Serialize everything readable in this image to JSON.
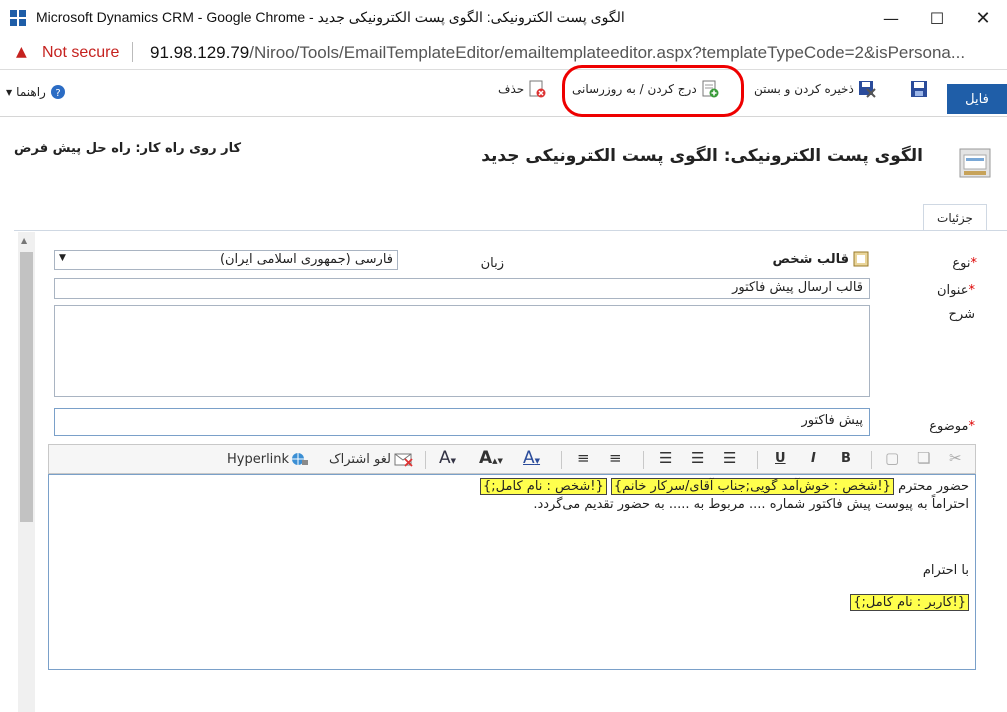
{
  "window": {
    "title": "Microsoft Dynamics CRM - Google Chrome - الگوی پست الکترونیکی: الگوی پست الکترونیکی جدید",
    "controls": [
      "minimize-icon",
      "maximize-icon",
      "close-icon"
    ]
  },
  "addressbar": {
    "security_label": "Not secure",
    "url_host": "91.98.129.79",
    "url_path": "/Niroo/Tools/EmailTemplateEditor/emailtemplateeditor.aspx?templateTypeCode=2&isPersona..."
  },
  "ribbon": {
    "file_tab": "فایل",
    "save_close": "ذخیره کردن و بستن",
    "insert_update": "درج کردن / به روزرسانی",
    "delete": "حذف",
    "help": "راهنما"
  },
  "header": {
    "title": "الگوی پست الکترونیکی: الگوی پست الکترونیکی جدید",
    "working_on": "کار روی راه کار: راه حل پیش فرض"
  },
  "tabs": {
    "details": "جزئیات"
  },
  "form": {
    "type_label": "نوع",
    "type_value": "قالب شخص",
    "language_label": "زبان",
    "language_value": "فارسی (جمهوری اسلامی ایران)",
    "title_label": "عنوان",
    "title_value": "قالب ارسال پیش فاکتور",
    "description_label": "شرح",
    "subject_label": "موضوع",
    "subject_value": "پیش فاکتور",
    "required_mark": "*"
  },
  "toolbar": {
    "hyperlink": "Hyperlink",
    "unsubscribe": "لغو اشتراک",
    "bold": "B",
    "italic": "I",
    "underline": "U",
    "font_color": "A",
    "font_size": "A",
    "highlight": "A"
  },
  "editor": {
    "greeting": "حضور محترم",
    "tag_salutation": "{!شخص : خوش‌آمد گویی;جناب آقای/سرکار خانم}",
    "tag_fullname": "{!شخص : نام کامل;}",
    "body_line": "احتراماً به پیوست پیش فاکتور شماره .... مربوط به ..... به حضور تقدیم می‌گردد.",
    "closing": "با احترام",
    "tag_user": "{!کاربر : نام کامل;}"
  },
  "colors": {
    "accent": "#1f5ea8",
    "warning": "#c5221f",
    "highlight": "#ffff4d",
    "annotation": "#e00000"
  }
}
